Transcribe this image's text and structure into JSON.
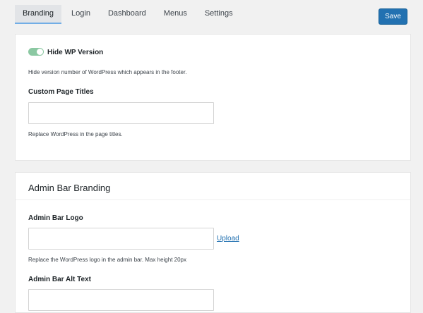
{
  "tabs": [
    {
      "label": "Branding",
      "active": true
    },
    {
      "label": "Login",
      "active": false
    },
    {
      "label": "Dashboard",
      "active": false
    },
    {
      "label": "Menus",
      "active": false
    },
    {
      "label": "Settings",
      "active": false
    }
  ],
  "toolbar": {
    "save_label": "Save"
  },
  "colors": {
    "primary": "#2271b1",
    "toggle_on": "#8bc8a2",
    "tab_active_underline": "#72aee6"
  },
  "general": {
    "hide_wp_version": {
      "label": "Hide WP Version",
      "enabled": true,
      "help": "Hide version number of WordPress which appears in the footer."
    },
    "custom_page_titles": {
      "label": "Custom Page Titles",
      "value": "",
      "help": "Replace WordPress in the page titles."
    }
  },
  "admin_bar": {
    "title": "Admin Bar Branding",
    "logo": {
      "label": "Admin Bar Logo",
      "value": "",
      "upload_label": "Upload",
      "help": "Replace the WordPress logo in the admin bar. Max height 20px"
    },
    "alt_text": {
      "label": "Admin Bar Alt Text",
      "value": ""
    }
  }
}
